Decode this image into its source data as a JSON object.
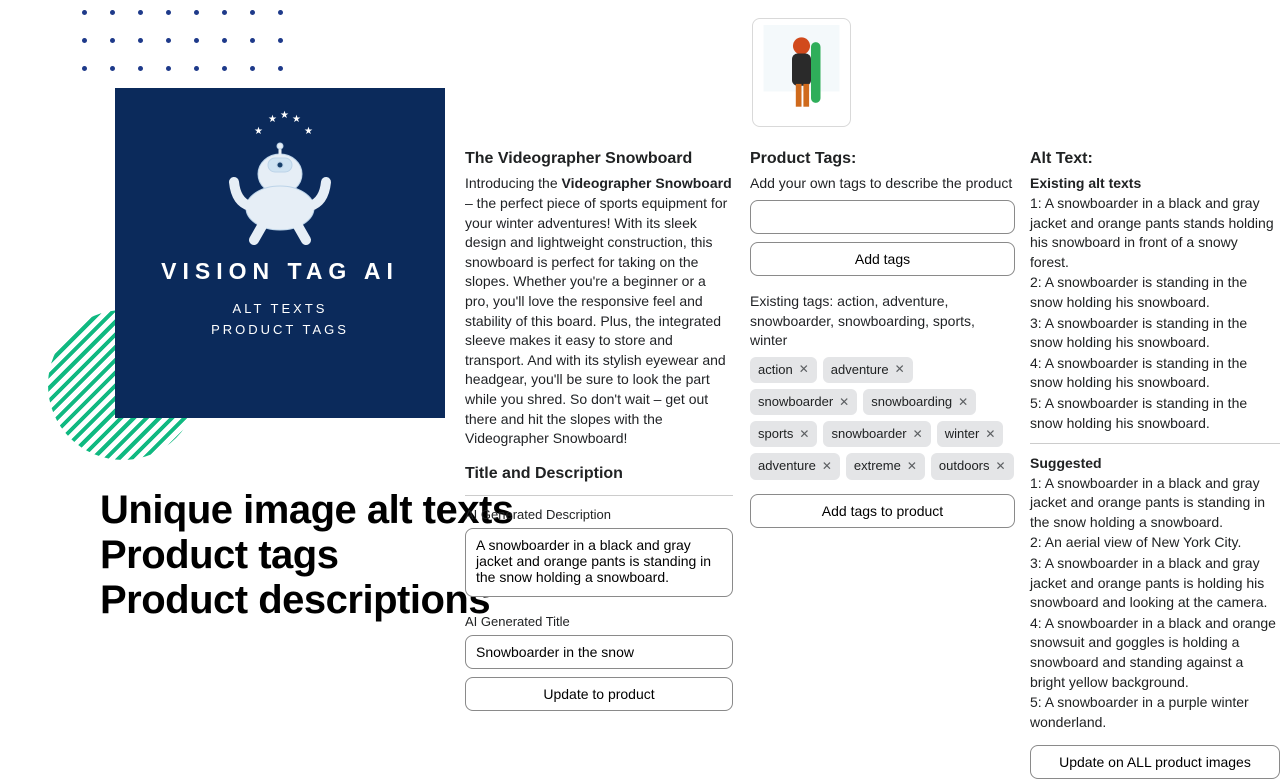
{
  "logo": {
    "title": "VISION TAG AI",
    "sub1": "ALT TEXTS",
    "sub2": "PRODUCT TAGS"
  },
  "headlines": [
    "Unique image alt texts",
    "Product tags",
    "Product descriptions"
  ],
  "product": {
    "title": "The Videographer Snowboard",
    "intro_prefix": "Introducing the ",
    "intro_bold": "Videographer Snowboard",
    "intro_rest": " – the perfect piece of sports equipment for your winter adventures! With its sleek design and lightweight construction, this snowboard is perfect for taking on the slopes. Whether you're a beginner or a pro, you'll love the responsive feel and stability of this board. Plus, the integrated sleeve makes it easy to store and transport. And with its stylish eyewear and headgear, you'll be sure to look the part while you shred. So don't wait – get out there and hit the slopes with the Videographer Snowboard!",
    "title_desc_heading": "Title and Description",
    "ai_desc_label": "AI Generated Description",
    "ai_desc_value": "A snowboarder in a black and gray jacket and orange pants is standing in the snow holding a snowboard.",
    "ai_title_label": "AI Generated Title",
    "ai_title_value": "Snowboarder in the snow",
    "update_button": "Update to product"
  },
  "tags_panel": {
    "heading": "Product Tags:",
    "hint": "Add your own tags to describe the product",
    "add_button": "Add tags",
    "existing_label": "Existing tags: action, adventure, snowboarder, snowboarding, sports, winter",
    "chips": [
      "action",
      "adventure",
      "snowboarder",
      "snowboarding",
      "sports",
      "snowboarder",
      "winter",
      "adventure",
      "extreme",
      "outdoors"
    ],
    "add_to_product": "Add tags to product"
  },
  "alt_panel": {
    "heading": "Alt Text:",
    "existing_heading": "Existing alt texts",
    "existing": [
      "1: A snowboarder in a black and gray jacket and orange pants stands holding his snowboard in front of a snowy forest.",
      "2: A snowboarder is standing in the snow holding his snowboard.",
      "3: A snowboarder is standing in the snow holding his snowboard.",
      "4: A snowboarder is standing in the snow holding his snowboard.",
      "5: A snowboarder is standing in the snow holding his snowboard."
    ],
    "suggested_heading": "Suggested",
    "suggested": [
      "1: A snowboarder in a black and gray jacket and orange pants is standing in the snow holding a snowboard.",
      "2: An aerial view of New York City.",
      "3: A snowboarder in a black and gray jacket and orange pants is holding his snowboard and looking at the camera.",
      "4: A snowboarder in a black and orange snowsuit and goggles is holding a snowboard and standing against a bright yellow background.",
      "5: A snowboarder in a purple winter wonderland."
    ],
    "update_all": "Update on ALL product images"
  }
}
